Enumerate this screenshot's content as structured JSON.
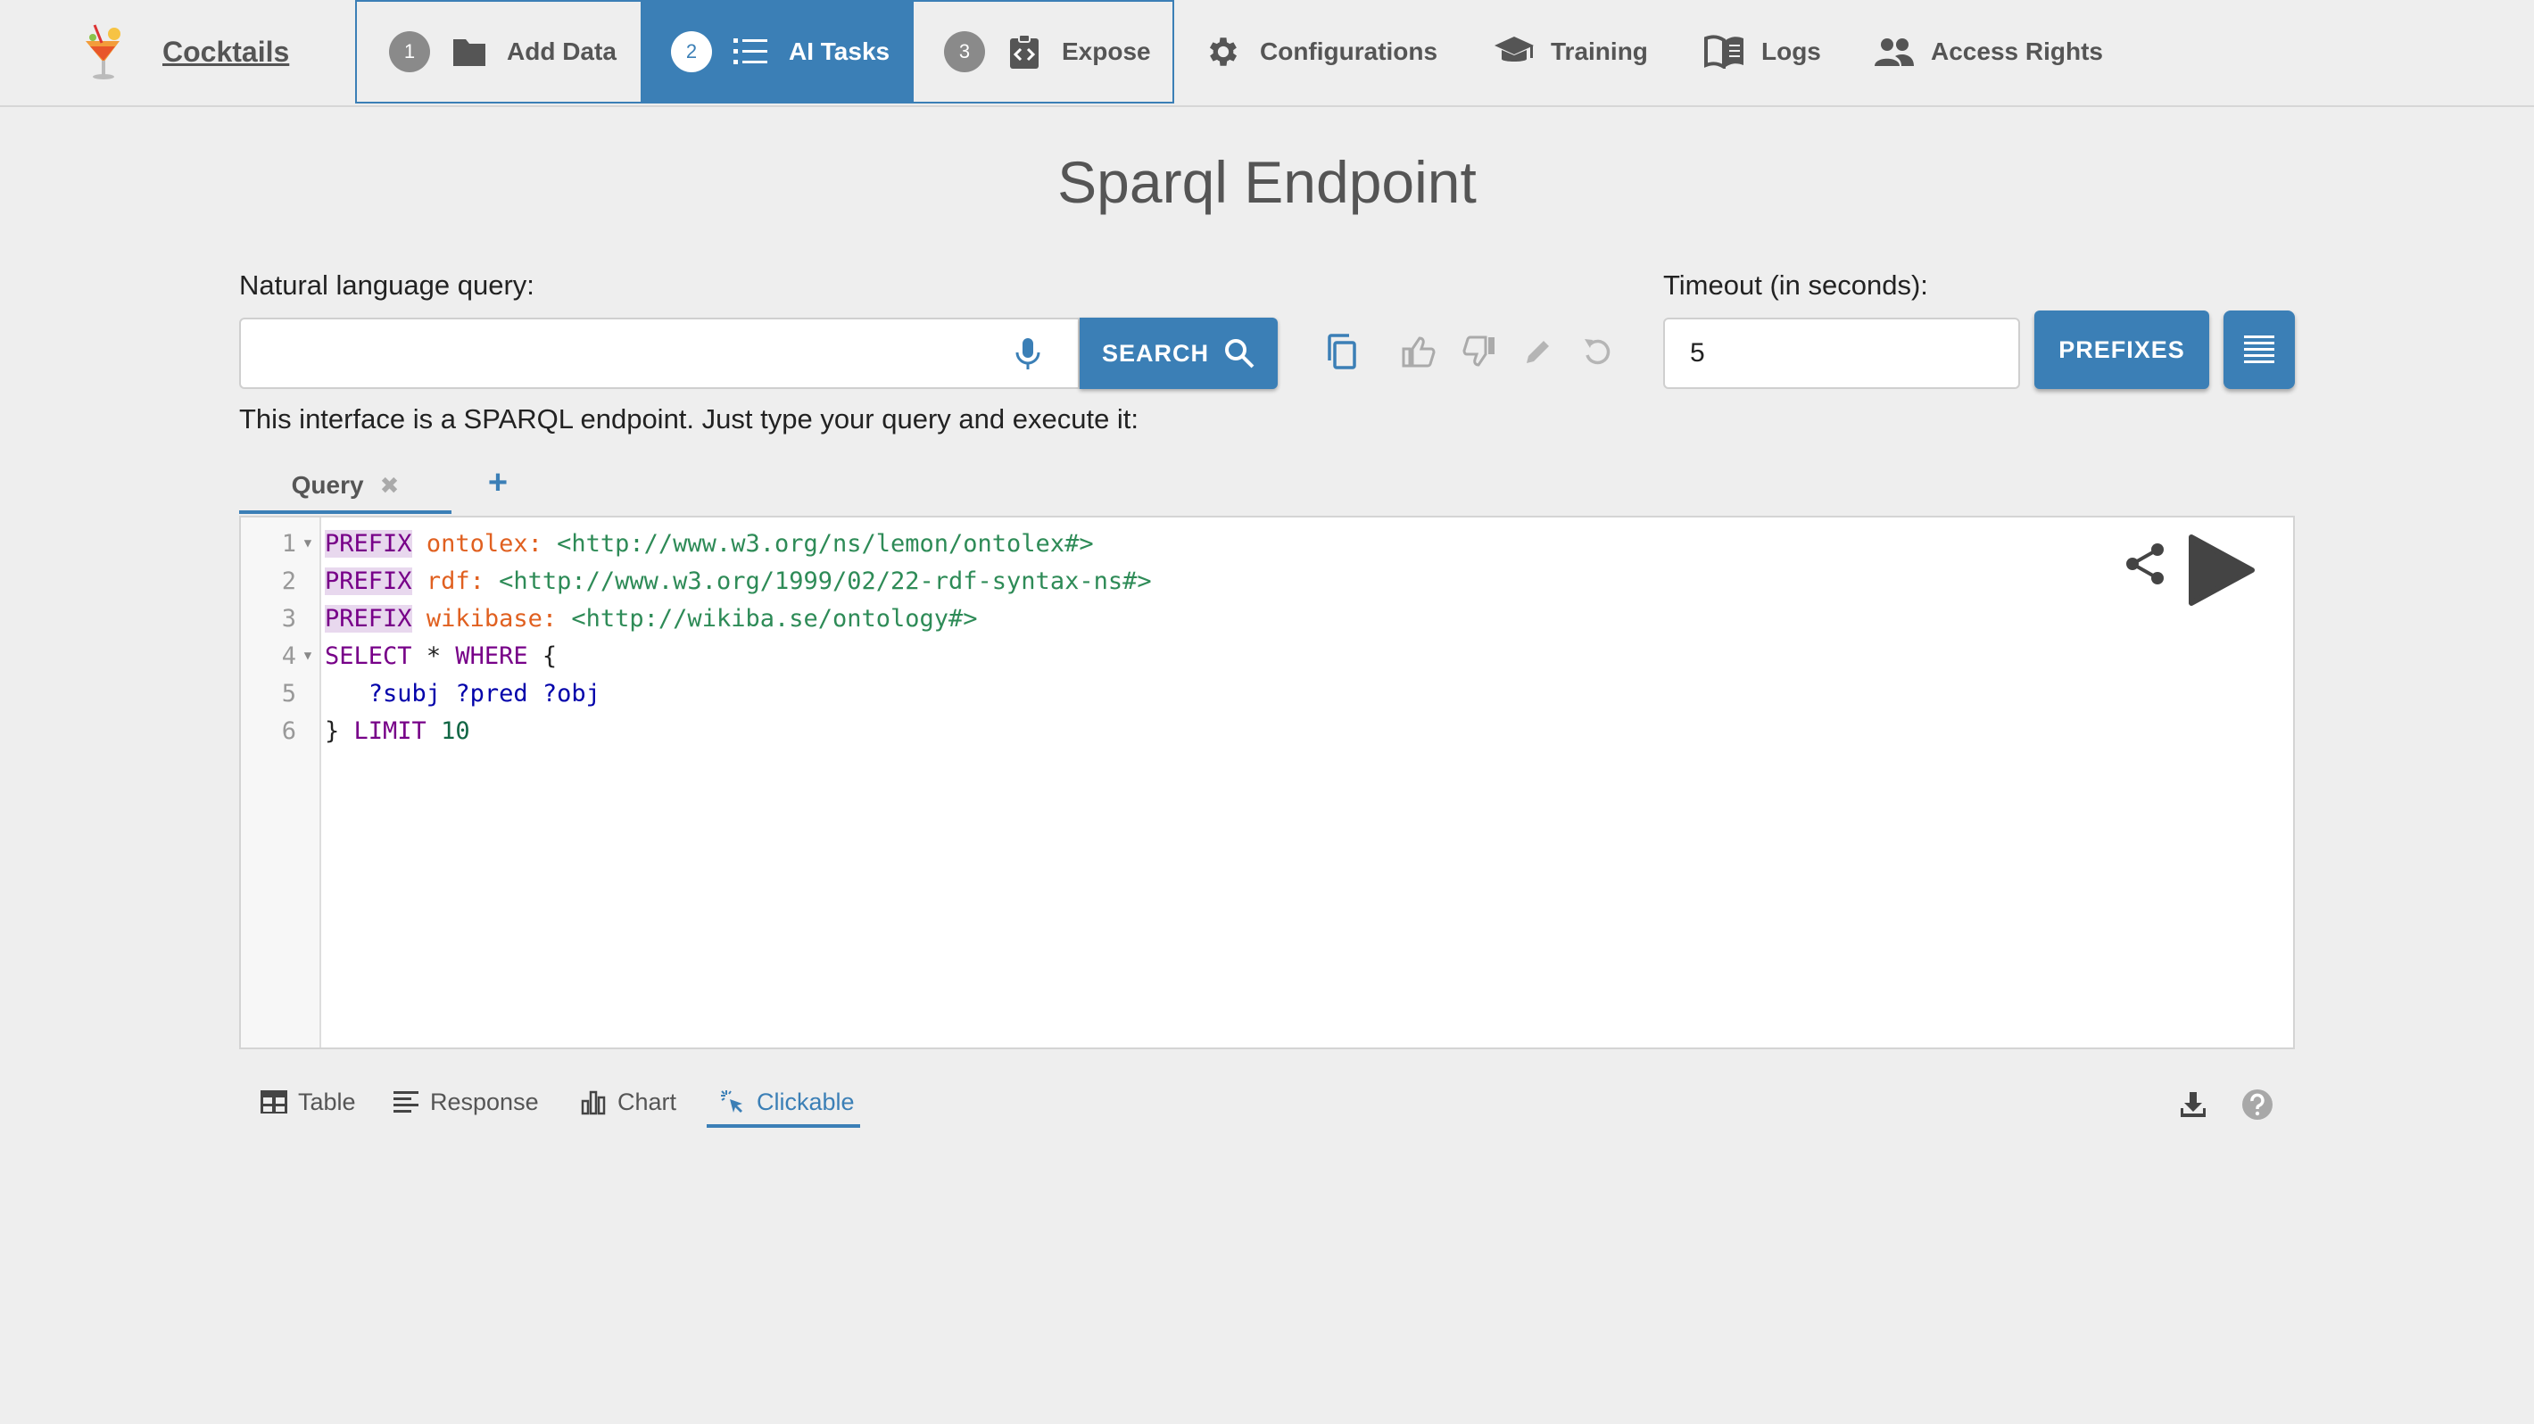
{
  "app": {
    "name": "Cocktails",
    "logo_icon": "cocktail-logo-icon"
  },
  "stepper": [
    {
      "num": "1",
      "label": "Add Data",
      "icon": "folder-icon"
    },
    {
      "num": "2",
      "label": "AI Tasks",
      "icon": "list-icon",
      "active": true
    },
    {
      "num": "3",
      "label": "Expose",
      "icon": "code-clipboard-icon"
    }
  ],
  "nav": [
    {
      "label": "Configurations",
      "icon": "gear-icon"
    },
    {
      "label": "Training",
      "icon": "graduation-cap-icon"
    },
    {
      "label": "Logs",
      "icon": "book-icon"
    },
    {
      "label": "Access Rights",
      "icon": "people-icon"
    }
  ],
  "page": {
    "title": "Sparql Endpoint"
  },
  "query_form": {
    "nl_label": "Natural language query:",
    "nl_value": "",
    "search_label": "SEARCH",
    "timeout_label": "Timeout (in seconds):",
    "timeout_value": "5",
    "prefixes_label": "PREFIXES",
    "helper_text": "This interface is a SPARQL endpoint. Just type your query and execute it:"
  },
  "tabs": {
    "query_tab": "Query",
    "close_glyph": "✖",
    "add_glyph": "+"
  },
  "editor": {
    "line_numbers": [
      "1",
      "2",
      "3",
      "4",
      "5",
      "6"
    ],
    "lines": {
      "l1": {
        "kw": "PREFIX",
        "pfx": "ontolex:",
        "iri": "<http://www.w3.org/ns/lemon/ontolex#>"
      },
      "l2": {
        "kw": "PREFIX",
        "pfx": "rdf:",
        "iri": "<http://www.w3.org/1999/02/22-rdf-syntax-ns#>"
      },
      "l3": {
        "kw": "PREFIX",
        "pfx": "wikibase:",
        "iri": "<http://wikiba.se/ontology#>"
      },
      "l4": {
        "select": "SELECT",
        "star": "*",
        "where": "WHERE",
        "brace": "{"
      },
      "l5": {
        "v1": "?subj",
        "v2": "?pred",
        "v3": "?obj"
      },
      "l6": {
        "brace": "}",
        "limit": "LIMIT",
        "num": "10"
      }
    }
  },
  "result_tabs": [
    {
      "label": "Table",
      "icon": "table-icon"
    },
    {
      "label": "Response",
      "icon": "response-lines-icon"
    },
    {
      "label": "Chart",
      "icon": "bar-chart-icon"
    },
    {
      "label": "Clickable",
      "icon": "pointer-click-icon",
      "active": true
    }
  ],
  "colors": {
    "accent": "#3b7fb6",
    "background": "#eeeeee",
    "keyword": "#770088",
    "prefix": "#e06020",
    "iri": "#2e8b57",
    "variable": "#0000aa"
  }
}
